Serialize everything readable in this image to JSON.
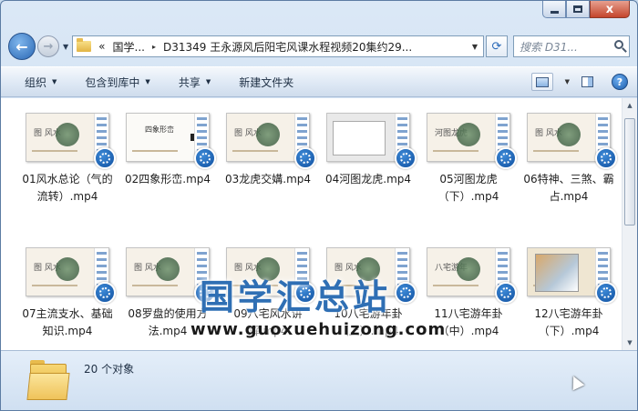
{
  "window": {
    "minimize_icon": "minimize-icon",
    "maximize_icon": "maximize-icon",
    "close_icon": "close-icon",
    "close_glyph": "x"
  },
  "nav": {
    "breadcrumb_overflow": "«",
    "breadcrumb_root": "国学...",
    "breadcrumb_sep": "▸",
    "breadcrumb_current": "D31349 王永源风后阳宅风课水程视频20集约29...",
    "search_placeholder": "搜索 D31..."
  },
  "toolbar": {
    "organize": "组织",
    "include_library": "包含到库中",
    "share": "共享",
    "new_folder": "新建文件夹",
    "help_glyph": "?"
  },
  "files": [
    {
      "label": "01风水总论（气的流转）.mp4",
      "thumb": "v1",
      "thumb_title": "图 风水"
    },
    {
      "label": "02四象形峦.mp4",
      "thumb": "v2",
      "thumb_title": "四象形峦"
    },
    {
      "label": "03龙虎交媾.mp4",
      "thumb": "v1",
      "thumb_title": "图 风水"
    },
    {
      "label": "04河图龙虎.mp4",
      "thumb": "v3",
      "thumb_title": ""
    },
    {
      "label": "05河图龙虎（下）.mp4",
      "thumb": "v1",
      "thumb_title": "河图龙虎"
    },
    {
      "label": "06特神、三煞、霸占.mp4",
      "thumb": "v1",
      "thumb_title": "图 风水"
    },
    {
      "label": "07主流支水、基础知识.mp4",
      "thumb": "v1",
      "thumb_title": "图 风水"
    },
    {
      "label": "08罗盘的使用方法.mp4",
      "thumb": "v1",
      "thumb_title": "图 风水"
    },
    {
      "label": "09八宅风水讲解.mp4",
      "thumb": "v1",
      "thumb_title": "图 风水"
    },
    {
      "label": "10八宅游年卦（上）.mp4",
      "thumb": "v1",
      "thumb_title": "图 风水"
    },
    {
      "label": "11八宅游年卦（中）.mp4",
      "thumb": "v1",
      "thumb_title": "八宅游年"
    },
    {
      "label": "12八宅游年卦（下）.mp4",
      "thumb": "v4",
      "thumb_title": ""
    }
  ],
  "watermark": {
    "title": "国学汇总站",
    "url": "www.guoxuehuizong.com"
  },
  "status": {
    "count": "20 个对象"
  }
}
